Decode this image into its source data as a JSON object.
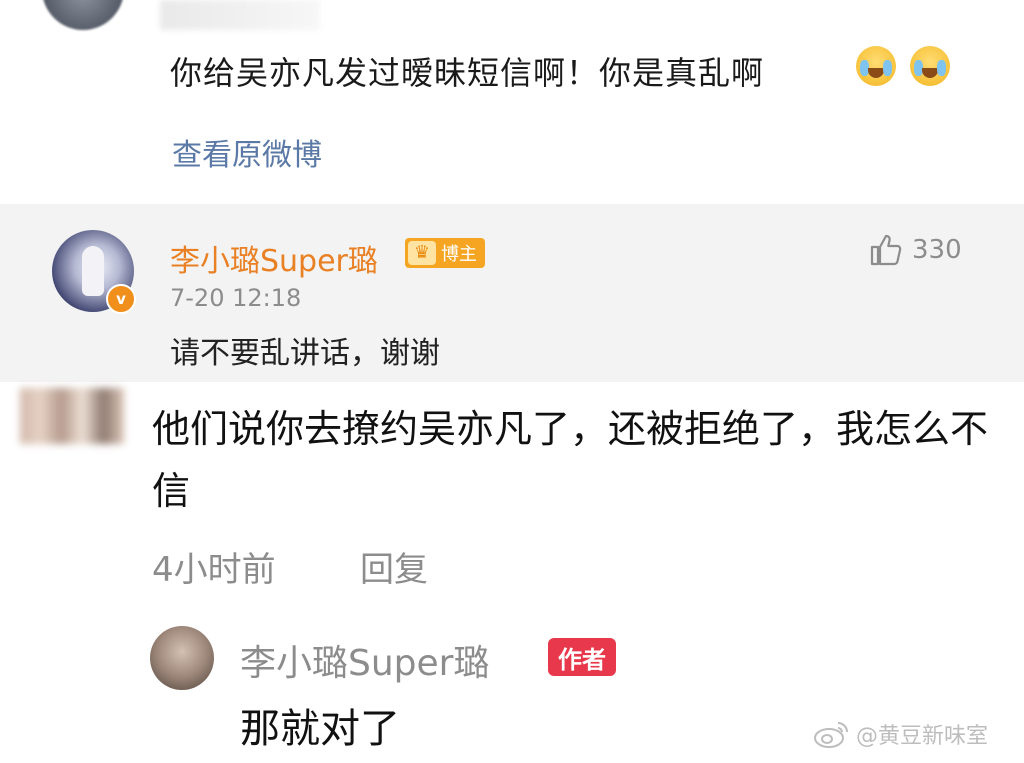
{
  "original_post": {
    "text": "你给吴亦凡发过暧昧短信啊！你是真乱啊",
    "emojis": [
      "crying-laughing-emoji",
      "crying-laughing-emoji"
    ],
    "view_original_label": "查看原微博"
  },
  "blogger_reply": {
    "name": "李小璐Super璐",
    "tag": "博主",
    "timestamp": "7-20 12:18",
    "text": "请不要乱讲话，谢谢",
    "like_count": "330",
    "name_color": "#e98024",
    "tag_color": "#f6a523"
  },
  "comment": {
    "text": "他们说你去撩约吴亦凡了，还被拒绝了，我怎么不信",
    "time": "4小时前",
    "reply_label": "回复"
  },
  "author_reply": {
    "name": "李小璐Super璐",
    "tag": "作者",
    "text": "那就对了",
    "tag_color": "#e8394c"
  },
  "watermark": {
    "text": "@黄豆新味室"
  }
}
